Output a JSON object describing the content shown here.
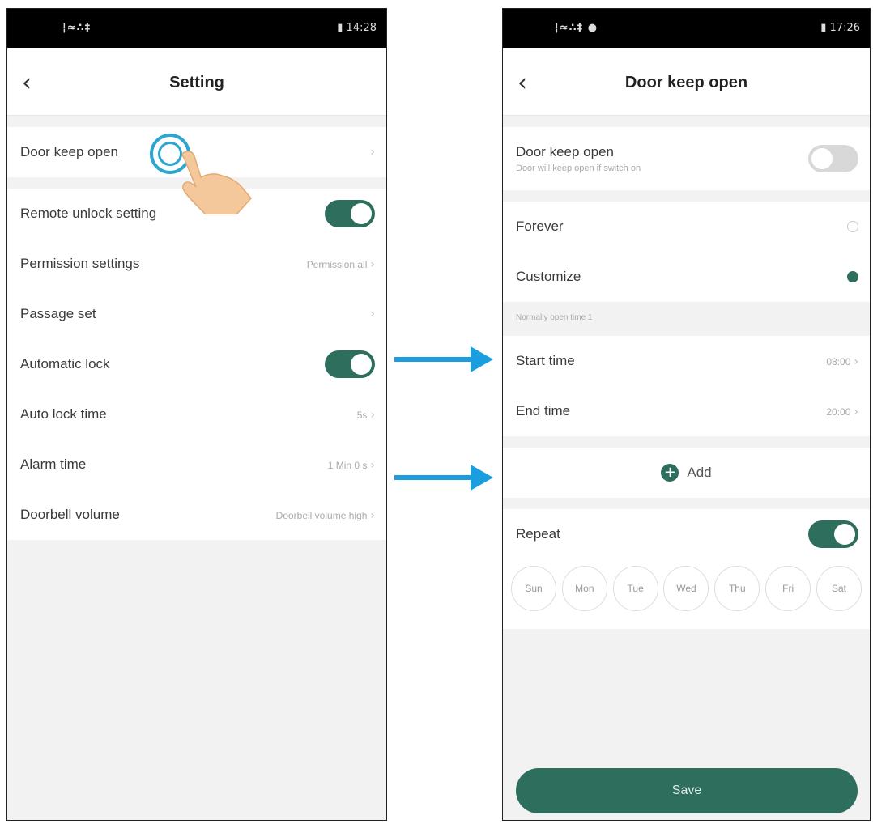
{
  "left": {
    "status": {
      "signal": "¦≈∴‡",
      "battery": "▮ 14:28"
    },
    "title": "Setting",
    "rows": [
      {
        "label": "Door keep open",
        "value": ""
      },
      {
        "label": "Remote unlock setting",
        "toggle": "on"
      },
      {
        "label": "Permission settings",
        "value": "Permission all"
      },
      {
        "label": "Passage set",
        "value": ""
      },
      {
        "label": "Automatic lock",
        "toggle": "on"
      },
      {
        "label": "Auto lock time",
        "value": "5s"
      },
      {
        "label": "Alarm time",
        "value": "1 Min 0 s"
      },
      {
        "label": "Doorbell volume",
        "value": "Doorbell volume high"
      }
    ]
  },
  "right": {
    "status": {
      "signal": "¦≈∴‡ ●",
      "battery": "▮ 17:26"
    },
    "title": "Door keep open",
    "keep_open": {
      "label": "Door keep open",
      "sub": "Door will keep open if switch on",
      "toggle": "off"
    },
    "mode_rows": [
      {
        "label": "Forever",
        "selected": false
      },
      {
        "label": "Customize",
        "selected": true
      }
    ],
    "note": "Normally open time 1",
    "time_rows": [
      {
        "label": "Start time",
        "value": "08:00"
      },
      {
        "label": "End time",
        "value": "20:00"
      }
    ],
    "add_label": "Add",
    "repeat_label": "Repeat",
    "repeat_toggle": "on",
    "days": [
      "Sun",
      "Mon",
      "Tue",
      "Wed",
      "Thu",
      "Fri",
      "Sat"
    ],
    "save_label": "Save"
  },
  "colors": {
    "accent": "#2e6e5c",
    "arrow": "#1a9ee0",
    "tap": "#2aa6d1"
  },
  "icons": {
    "back": "chevron-left-icon",
    "chevron": "chevron-right-icon",
    "add": "plus-circle-icon",
    "hand": "tap-hand-icon"
  }
}
